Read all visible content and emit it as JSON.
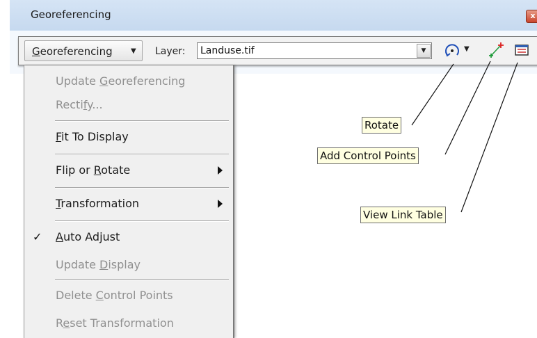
{
  "window": {
    "title": "Georeferencing",
    "close_glyph": "x"
  },
  "toolbar": {
    "georeferencing_menu": {
      "prefix": "G",
      "rest": "eoreferencing",
      "arrow": "▼"
    },
    "layer_label": "Layer:",
    "layer_value": "Landuse.tif",
    "combo_arrow": "▼",
    "rotate_dropdown_arrow": "▼",
    "icons": [
      "rotate-icon",
      "add-control-points-icon",
      "view-link-table-icon"
    ]
  },
  "menu": {
    "items": [
      {
        "pre": "Update ",
        "u": "G",
        "post": "eoreferencing",
        "enabled": false
      },
      {
        "pre": "Recti",
        "u": "f",
        "post": "y...",
        "enabled": false
      },
      {
        "pre": "",
        "u": "F",
        "post": "it To Display",
        "enabled": true
      },
      {
        "pre": "Flip or ",
        "u": "R",
        "post": "otate",
        "enabled": true,
        "submenu": true
      },
      {
        "pre": "",
        "u": "T",
        "post": "ransformation",
        "enabled": true,
        "submenu": true
      },
      {
        "pre": "",
        "u": "A",
        "post": "uto Adjust",
        "enabled": true,
        "checked": true
      },
      {
        "pre": "Update ",
        "u": "D",
        "post": "isplay",
        "enabled": false
      },
      {
        "pre": "Delete ",
        "u": "C",
        "post": "ontrol Points",
        "enabled": false
      },
      {
        "pre": "R",
        "u": "e",
        "post": "set Transformation",
        "enabled": false
      }
    ],
    "check_glyph": "✓"
  },
  "callouts": {
    "rotate": "Rotate",
    "add_control_points": "Add Control Points",
    "view_link_table": "View Link Table"
  },
  "colors": {
    "titlebar": "#c6d9ef",
    "menu_bg": "#f0f0f0",
    "disabled_text": "#8f8f8f",
    "callout_bg": "#ffffe1"
  }
}
